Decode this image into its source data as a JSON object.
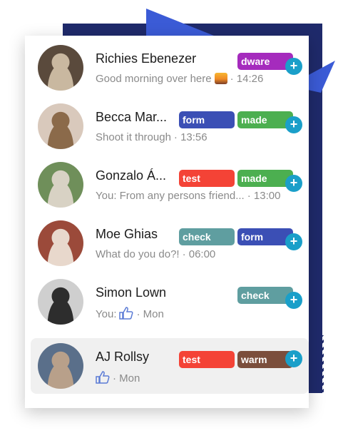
{
  "conversations": [
    {
      "name": "Richies Ebenezer",
      "snippet": "Good morning over here",
      "time": "· 14:26",
      "tags": [
        {
          "label": "dware",
          "color": "#a52bbd"
        }
      ],
      "avatar_colors": [
        "#5a4a3c",
        "#c9b8a0"
      ]
    },
    {
      "name": "Becca Mar...",
      "snippet": "Shoot it through",
      "time": "· 13:56",
      "tags": [
        {
          "label": "form",
          "color": "#3b4fb5"
        },
        {
          "label": "made",
          "color": "#4caf50"
        }
      ],
      "avatar_colors": [
        "#d9c9bc",
        "#8b6a4a"
      ]
    },
    {
      "name": "Gonzalo Á...",
      "snippet": "You: From any persons friend...",
      "time": "· 13:00",
      "tags": [
        {
          "label": "test",
          "color": "#f44336"
        },
        {
          "label": "made",
          "color": "#4caf50"
        }
      ],
      "avatar_colors": [
        "#6f8f5a",
        "#d8d2c4"
      ]
    },
    {
      "name": "Moe Ghias",
      "snippet": "What do you do?!",
      "time": "· 06:00",
      "tags": [
        {
          "label": "check",
          "color": "#5f9ea0"
        },
        {
          "label": "form",
          "color": "#3b4fb5"
        }
      ],
      "avatar_colors": [
        "#9b4a3a",
        "#e8d8cc"
      ]
    },
    {
      "name": "Simon Lown",
      "snippet": "You:",
      "time": "· Mon",
      "tags": [
        {
          "label": "check",
          "color": "#5f9ea0"
        }
      ],
      "avatar_colors": [
        "#cfcfcf",
        "#2d2d2d"
      ]
    },
    {
      "name": "AJ Rollsy",
      "snippet": "",
      "time": "· Mon",
      "tags": [
        {
          "label": "test",
          "color": "#f44336"
        },
        {
          "label": "warm",
          "color": "#7b4e3c"
        }
      ],
      "avatar_colors": [
        "#5a6f8a",
        "#b8a08a"
      ]
    }
  ],
  "icons": {
    "add": "plus-icon",
    "like": "thumbs-up-icon",
    "emoji": "sunset-emoji-icon"
  },
  "add_symbol": "+"
}
